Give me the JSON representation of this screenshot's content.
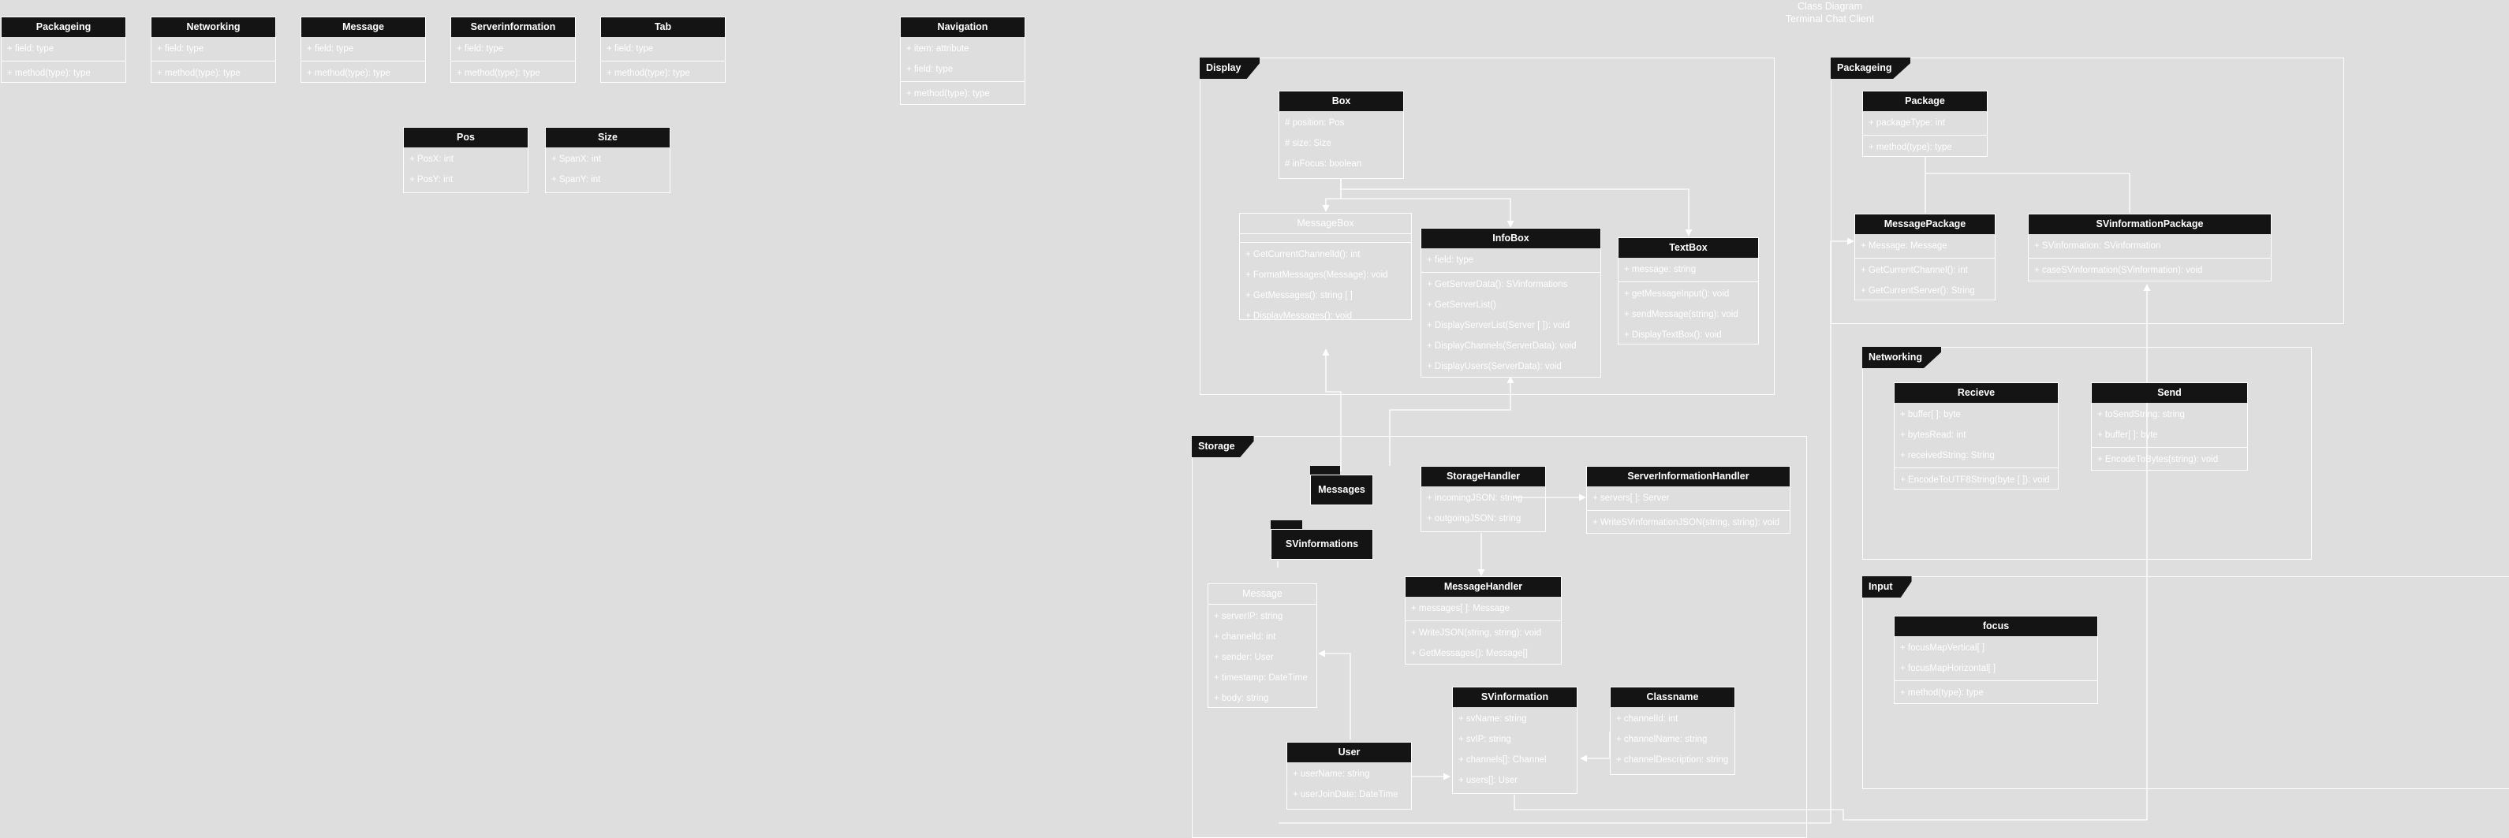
{
  "diagram_title": [
    "Class Diagram",
    "Terminal Chat Client"
  ],
  "packages": [
    {
      "id": "display",
      "name": "Display"
    },
    {
      "id": "storage",
      "name": "Storage"
    },
    {
      "id": "packaging",
      "name": "Packageing"
    },
    {
      "id": "networking",
      "name": "Networking"
    },
    {
      "id": "input",
      "name": "Input"
    }
  ],
  "folders": [
    {
      "id": "messages",
      "name": "Messages"
    },
    {
      "id": "svinformations",
      "name": "SVinformations"
    }
  ],
  "classes": [
    {
      "id": "leg-packageing",
      "name": "Packageing",
      "sections": [
        [
          "+ field: type"
        ],
        [
          "+ method(type): type"
        ]
      ]
    },
    {
      "id": "leg-networking",
      "name": "Networking",
      "sections": [
        [
          "+ field: type"
        ],
        [
          "+ method(type): type"
        ]
      ]
    },
    {
      "id": "leg-message",
      "name": "Message",
      "sections": [
        [
          "+ field: type"
        ],
        [
          "+ method(type): type"
        ]
      ]
    },
    {
      "id": "leg-serverinformation",
      "name": "Serverinformation",
      "sections": [
        [
          "+ field: type"
        ],
        [
          "+ method(type): type"
        ]
      ]
    },
    {
      "id": "leg-tab",
      "name": "Tab",
      "sections": [
        [
          "+ field: type"
        ],
        [
          "+ method(type): type"
        ]
      ]
    },
    {
      "id": "leg-navigation",
      "name": "Navigation",
      "sections": [
        [
          "+ item: attribute",
          "+ field: type"
        ],
        [
          "+ method(type): type"
        ]
      ]
    },
    {
      "id": "leg-pos",
      "name": "Pos",
      "sections": [
        [
          "+ PosX: int",
          "+ PosY: int"
        ]
      ]
    },
    {
      "id": "leg-size",
      "name": "Size",
      "sections": [
        [
          "+ SpanX: int",
          "+ SpanY: int"
        ]
      ]
    },
    {
      "id": "box",
      "name": "Box",
      "sections": [
        [
          "# position: Pos",
          "# size: Size",
          "# inFocus: boolean"
        ]
      ]
    },
    {
      "id": "messagebox",
      "name": "MessageBox",
      "abstract": true,
      "sections": [
        [],
        [
          "+ GetCurrentChannelId(): int",
          "+ FormatMessages(Message): void",
          "+ GetMessages(): string [ ]",
          "+ DisplayMessages(): void"
        ]
      ]
    },
    {
      "id": "infobox",
      "name": "InfoBox",
      "sections": [
        [
          "+ field: type"
        ],
        [
          "+ GetServerData(): SVinformations",
          "+ GetServerList()",
          "+ DisplayServerList(Server [ ]): void",
          "+ DisplayChannels(ServerData): void",
          "+ DisplayUsers(ServerData): void"
        ]
      ]
    },
    {
      "id": "textbox",
      "name": "TextBox",
      "sections": [
        [
          "+ message: string"
        ],
        [
          "+ getMessageInput(): void",
          "+ sendMessage(string): void",
          "+ DisplayTextBox(): void"
        ]
      ]
    },
    {
      "id": "package",
      "name": "Package",
      "sections": [
        [
          "+ packageType: int"
        ],
        [
          "+ method(type): type"
        ]
      ]
    },
    {
      "id": "messagepackage",
      "name": "MessagePackage",
      "sections": [
        [
          "+ Message: Message"
        ],
        [
          "+ GetCurrentChannel(): int",
          "+ GetCurrentServer(): String"
        ]
      ]
    },
    {
      "id": "svinformationpackage",
      "name": "SVinformationPackage",
      "sections": [
        [
          "+ SVinformation: SVinformation"
        ],
        [
          "+ caseSVinformation(SVinformation): void"
        ]
      ]
    },
    {
      "id": "recieve",
      "name": "Recieve",
      "sections": [
        [
          "+ buffer[ ]: byte",
          "+ bytesRead: int",
          "+ receivedString: String"
        ],
        [
          "+ EncodeToUTF8String(byte [ ]): void"
        ]
      ]
    },
    {
      "id": "send",
      "name": "Send",
      "sections": [
        [
          "+ toSendString: string",
          "+ buffer[ ]: byte"
        ],
        [
          "+ EncodeToBytes(string): void"
        ]
      ]
    },
    {
      "id": "focus",
      "name": "focus",
      "sections": [
        [
          "+ focusMapVertical[ ]",
          "+ focusMapHorizontal[ ]"
        ],
        [
          "+ method(type): type"
        ]
      ]
    },
    {
      "id": "storagehandler",
      "name": "StorageHandler",
      "sections": [
        [
          "+ incomingJSON: string",
          "+ outgoingJSON: string"
        ]
      ]
    },
    {
      "id": "serverinformationhandler",
      "name": "ServerInformationHandler",
      "sections": [
        [
          "+ servers[ ]: Server"
        ],
        [
          "+ WriteSVinformationJSON(string, string): void"
        ]
      ]
    },
    {
      "id": "message",
      "name": "Message",
      "abstract": true,
      "sections": [
        [
          "+ serverIP: string",
          "+ channelId: int",
          "+ sender: User",
          "+ timestamp: DateTime",
          "+ body: string"
        ]
      ]
    },
    {
      "id": "messagehandler",
      "name": "MessageHandler",
      "sections": [
        [
          "+ messages[ ]: Message"
        ],
        [
          "+ WriteJSON(string, string): void",
          "+ GetMessages(): Message[]"
        ]
      ]
    },
    {
      "id": "svinformation",
      "name": "SVinformation",
      "sections": [
        [
          "+ svName: string",
          "+ svIP: string",
          "+ channels[]: Channel",
          "+ users[]: User"
        ]
      ]
    },
    {
      "id": "classname",
      "name": "Classname",
      "sections": [
        [
          "+ channelId: int",
          "+ channelName: string",
          "+ channelDescription: string"
        ]
      ]
    },
    {
      "id": "user",
      "name": "User",
      "sections": [
        [
          "+ userName: string",
          "+ userJoinDate: DateTime"
        ]
      ]
    }
  ]
}
